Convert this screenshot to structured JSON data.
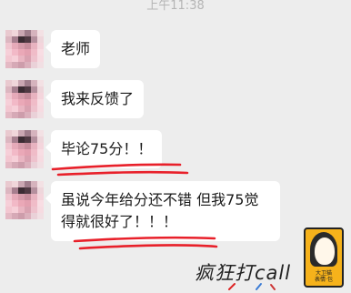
{
  "status": {
    "time": "上午11:38"
  },
  "messages": [
    {
      "text": "老师"
    },
    {
      "text": "我来反馈了"
    },
    {
      "text": "毕论75分！！"
    },
    {
      "text": "虽说今年给分还不错 但我75觉\n得就很好了！！！"
    }
  ],
  "sticker": {
    "text": "疯狂打call",
    "caption_line1": "大卫猫",
    "caption_line2": "表情·包"
  },
  "colors": {
    "background": "#ededed",
    "bubble": "#ffffff",
    "underline": "#e8202a",
    "sticker_bg": "#f6b21b"
  }
}
